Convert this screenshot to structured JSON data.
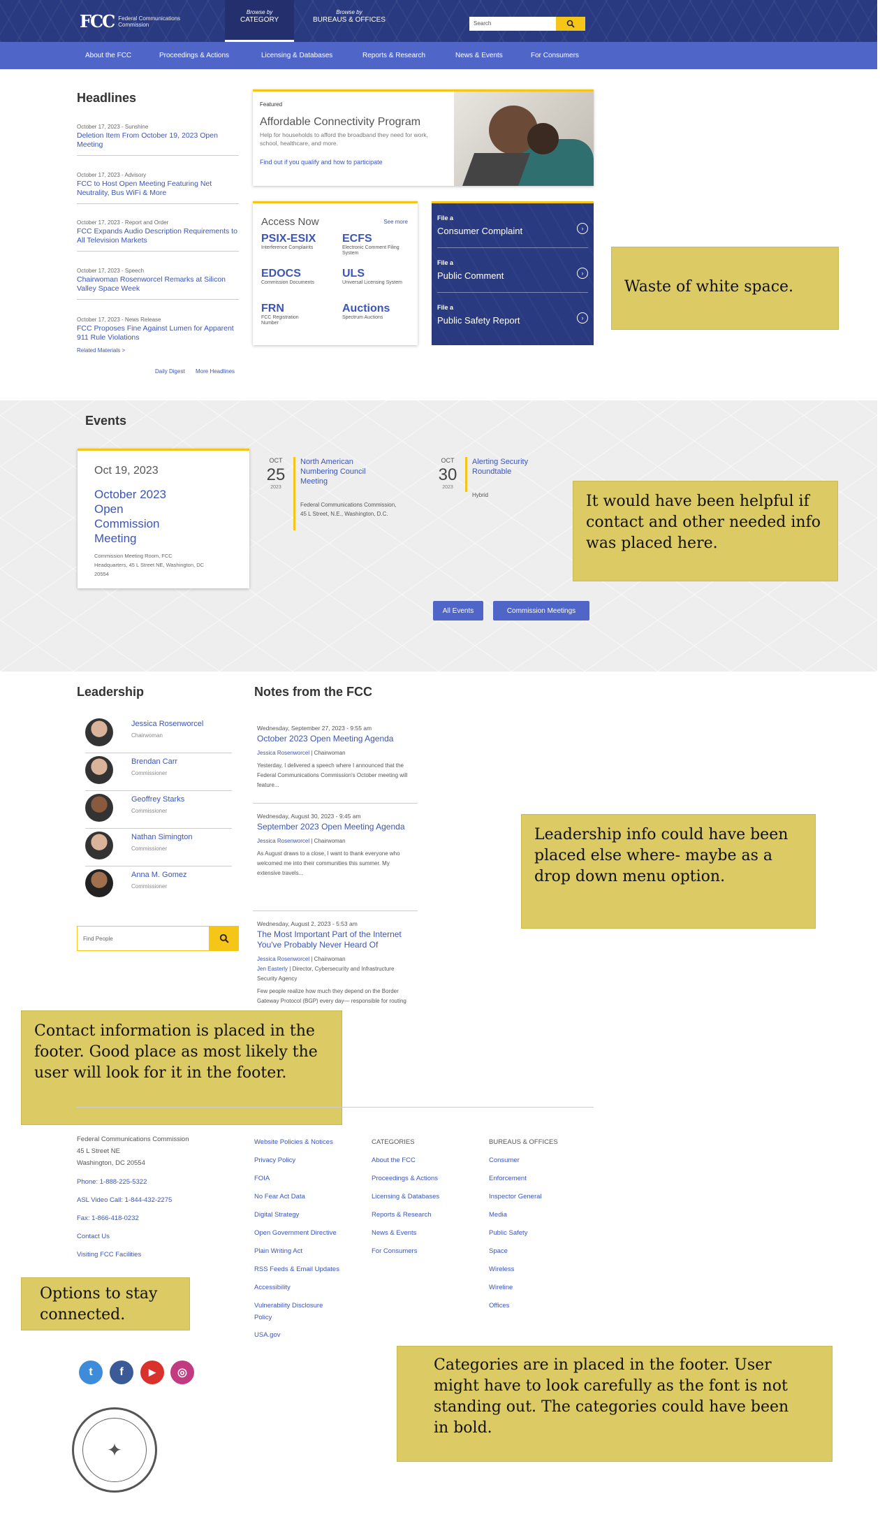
{
  "header": {
    "logo_mark": "FCC",
    "logo_text": "Federal Communications Commission",
    "browse_category_small": "Browse by",
    "browse_category_big": "CATEGORY",
    "browse_bureaus_small": "Browse by",
    "browse_bureaus_big": "BUREAUS & OFFICES",
    "search_placeholder": "Search",
    "search_icon": "magnifier-icon"
  },
  "nav": [
    "About the FCC",
    "Proceedings & Actions",
    "Licensing & Databases",
    "Reports & Research",
    "News & Events",
    "For Consumers"
  ],
  "headlines": {
    "title": "Headlines",
    "items": [
      {
        "meta": "October 17, 2023  -  Sunshine",
        "title": "Deletion Item From October 19, 2023 Open Meeting"
      },
      {
        "meta": "October 17, 2023  -  Advisory",
        "title": "FCC to Host Open Meeting Featuring Net Neutrality, Bus WiFi & More"
      },
      {
        "meta": "October 17, 2023  -  Report and Order",
        "title": "FCC Expands Audio Description Requirements to All Television Markets"
      },
      {
        "meta": "October 17, 2023  -  Speech",
        "title": "Chairwoman Rosenworcel Remarks at Silicon Valley Space Week"
      },
      {
        "meta": "October 17, 2023  -  News Release",
        "title": "FCC Proposes Fine Against Lumen for Apparent 911 Rule Violations"
      }
    ],
    "related": "Related Materials >",
    "daily_digest": "Daily Digest",
    "more_headlines": "More Headlines"
  },
  "featured": {
    "label": "Featured",
    "title": "Affordable Connectivity Program",
    "description": "Help for households to afford the broadband they need for work, school, healthcare, and more.",
    "link": "Find out if you qualify and how to participate"
  },
  "access": {
    "title": "Access Now",
    "see_more": "See more",
    "items": [
      {
        "name": "PSIX-ESIX",
        "desc": "Interference Complaints"
      },
      {
        "name": "ECFS",
        "desc": "Electronic Comment Filing System"
      },
      {
        "name": "EDOCS",
        "desc": "Commission Documents"
      },
      {
        "name": "ULS",
        "desc": "Universal Licensing System"
      },
      {
        "name": "FRN",
        "desc": "FCC Registration Number"
      },
      {
        "name": "Auctions",
        "desc": "Spectrum Auctions"
      }
    ]
  },
  "file": [
    {
      "small": "File a",
      "big": "Consumer Complaint"
    },
    {
      "small": "File a",
      "big": "Public Comment"
    },
    {
      "small": "File a",
      "big": "Public Safety Report"
    }
  ],
  "events": {
    "title": "Events",
    "card": {
      "date": "Oct 19, 2023",
      "title": "October 2023 Open Commission Meeting",
      "location": "Commission Meeting Room, FCC Headquarters, 45 L Street NE, Washington, DC 20554"
    },
    "list": [
      {
        "month": "OCT",
        "day": "25",
        "year": "2023",
        "title": "North American Numbering Council Meeting",
        "location": "Federal Communications Commission, 45 L Street, N.E., Washington, D.C."
      },
      {
        "month": "OCT",
        "day": "30",
        "year": "2023",
        "title": "Alerting Security Roundtable",
        "location": "Hybrid"
      }
    ],
    "all_events": "All Events",
    "commission_meetings": "Commission Meetings"
  },
  "leadership": {
    "title": "Leadership",
    "people": [
      {
        "name": "Jessica Rosenworcel",
        "role": "Chairwoman"
      },
      {
        "name": "Brendan Carr",
        "role": "Commissioner"
      },
      {
        "name": "Geoffrey Starks",
        "role": "Commissioner"
      },
      {
        "name": "Nathan Simington",
        "role": "Commissioner"
      },
      {
        "name": "Anna M. Gomez",
        "role": "Commissioner"
      }
    ],
    "find_placeholder": "Find People"
  },
  "notes": {
    "title": "Notes from the FCC",
    "items": [
      {
        "date": "Wednesday, September 27, 2023 - 9:55 am",
        "title": "October 2023 Open Meeting Agenda",
        "author": "Jessica Rosenworcel",
        "author_role": "Chairwoman",
        "excerpt": "Yesterday, I delivered a speech where I announced that the Federal Communications Commission's October meeting will feature..."
      },
      {
        "date": "Wednesday, August 30, 2023 - 9:45 am",
        "title": "September 2023 Open Meeting Agenda",
        "author": "Jessica Rosenworcel",
        "author_role": "Chairwoman",
        "excerpt": "As August draws to a close, I want to thank everyone who welcomed me into their communities this summer. My extensive travels..."
      },
      {
        "date": "Wednesday, August 2, 2023 - 5:53 am",
        "title": "The Most Important Part of the Internet You've Probably Never Heard Of",
        "author": "Jessica Rosenworcel",
        "author_role": "Chairwoman",
        "author2": "Jen Easterly",
        "author2_role": "Director, Cybersecurity and Infrastructure Security Agency",
        "excerpt": "Few people realize how much they depend on the Border Gateway Protocol (BGP) every day— responsible for routing"
      }
    ]
  },
  "footer": {
    "org": [
      "Federal Communications Commission",
      "45 L Street NE",
      "Washington, DC 20554"
    ],
    "contact": [
      "Phone: 1-888-225-5322",
      "ASL Video Call: 1-844-432-2275",
      "Fax: 1-866-418-0232",
      "Contact Us",
      "Visiting FCC Facilities"
    ],
    "policies": [
      "Website Policies & Notices",
      "Privacy Policy",
      "FOIA",
      "No Fear Act Data",
      "Digital Strategy",
      "Open Government Directive",
      "Plain Writing Act",
      "RSS Feeds & Email Updates",
      "Accessibility",
      "Vulnerability Disclosure Policy",
      "USA.gov"
    ],
    "categories_head": "Categories",
    "categories": [
      "About the FCC",
      "Proceedings & Actions",
      "Licensing & Databases",
      "Reports & Research",
      "News & Events",
      "For Consumers"
    ],
    "bureaus_head": "Bureaus & Offices",
    "bureaus": [
      "Consumer",
      "Enforcement",
      "Inspector General",
      "Media",
      "Public Safety",
      "Space",
      "Wireless",
      "Wireline",
      "Offices"
    ],
    "social": [
      {
        "icon": "twitter-icon",
        "glyph": "t",
        "color": "#3d8bd9"
      },
      {
        "icon": "facebook-icon",
        "glyph": "f",
        "color": "#3a5a98"
      },
      {
        "icon": "youtube-icon",
        "glyph": "▶",
        "color": "#d9312b"
      },
      {
        "icon": "instagram-icon",
        "glyph": "◎",
        "color": "#c23a7f"
      }
    ]
  },
  "annotations": [
    "Waste of white space.",
    "It would have been helpful if contact and other needed info was placed here.",
    "Leadership info could have been placed else where- maybe as a drop down menu option.",
    "Contact information is placed in the footer. Good place as most likely the user will look for it in the footer.",
    "Options to stay connected.",
    "Categories are in placed in the footer. User might have to look carefully as the font is not standing out. The categories could have been in bold."
  ]
}
